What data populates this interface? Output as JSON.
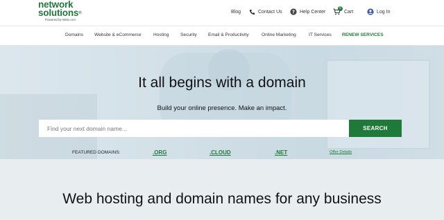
{
  "header": {
    "logo_line1": "network",
    "logo_line2": "solutions",
    "logo_tm": "®",
    "logo_powered": "Powered by Web.com",
    "blog": "Blog",
    "contact": "Contact Us",
    "help": "Help Center",
    "cart": "Cart",
    "cart_count": "0",
    "login": "Log In"
  },
  "nav": {
    "items": [
      {
        "label": "Domains"
      },
      {
        "label": "Website & eCommerce"
      },
      {
        "label": "Hosting"
      },
      {
        "label": "Security"
      },
      {
        "label": "Email & Productivity"
      },
      {
        "label": "Online Marketing"
      },
      {
        "label": "IT Services"
      },
      {
        "label": "RENEW SERVICES"
      }
    ]
  },
  "hero": {
    "title": "It all begins with a domain",
    "subtitle": "Build your online presence. Make an impact.",
    "search_placeholder": "Find your next domain name...",
    "search_value": "",
    "search_button": "SEARCH",
    "featured_label": "FEATURED DOMAINS:",
    "featured": [
      ".ORG",
      ".CLOUD",
      ".NET"
    ],
    "offer_details": "Offer Details"
  },
  "section": {
    "title": "Web hosting and domain names for any business"
  },
  "colors": {
    "brand_green": "#1f7a3a",
    "section_bg": "#e8edf0"
  },
  "icons": {
    "contact": "phone-icon",
    "help": "help-circle-icon",
    "cart": "cart-icon",
    "login": "user-circle-icon"
  }
}
